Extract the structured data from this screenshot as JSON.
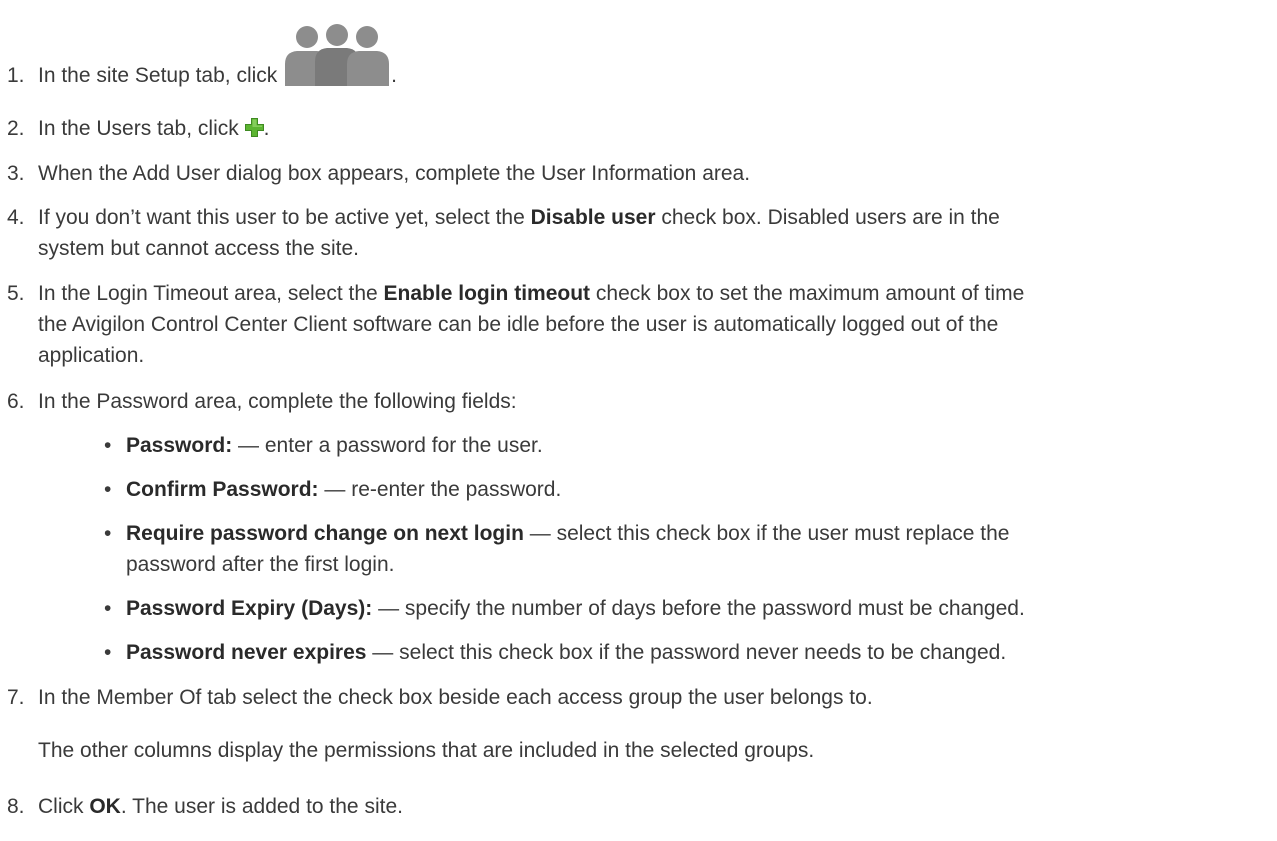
{
  "steps": [
    {
      "num": "1.",
      "pre": "In the site Setup tab, click ",
      "post": "."
    },
    {
      "num": "2.",
      "pre": "In the Users tab, click ",
      "post": "."
    },
    {
      "num": "3.",
      "text": "When the Add User dialog box appears, complete the User Information area."
    },
    {
      "num": "4.",
      "pre": "If you don’t want this user to be active yet, select the ",
      "bold": "Disable user",
      "post": " check box. Disabled users are in the"
    },
    {
      "num": "5.",
      "pre": "In the Login Timeout area, select the ",
      "bold": "Enable login timeout",
      "post": " check box to set the maximum amount of time"
    },
    {
      "num": "6.",
      "text": "In the Password area, complete the following fields:"
    },
    {
      "num": "7.",
      "text": "In the Member Of tab select the check box beside each access group the user belongs to."
    },
    {
      "num": "8.",
      "pre": "Click ",
      "bold": "OK",
      "post": ". The user is added to the site."
    }
  ],
  "step4_line2": "system but cannot access the site.",
  "step5_line2": "the Avigilon Control Center Client software can be idle before the user is automatically logged out of the",
  "step5_line3": "application.",
  "bullets": [
    {
      "dot": "•",
      "bold": "Password:",
      "text": " — enter a password for the user."
    },
    {
      "dot": "•",
      "bold": "Confirm Password:",
      "text": " — re-enter the password."
    },
    {
      "dot": "•",
      "bold": "Require password change on next login",
      "text": " — select this check box if the user must replace the"
    },
    {
      "dot": "•",
      "bold": "Password Expiry (Days):",
      "text": " — specify the number of days before the password must be changed."
    },
    {
      "dot": "•",
      "bold": "Password never expires",
      "text": " — select this check box if the password never needs to be changed."
    }
  ],
  "bullet3_line2": "password after the first login.",
  "step7_note": "The other columns display the permissions that are included in the selected groups.",
  "icons": {
    "users": "users-group-icon",
    "add": "green-plus-icon"
  },
  "colors": {
    "plus": "#5cb531",
    "users": "#8a8a8a"
  }
}
